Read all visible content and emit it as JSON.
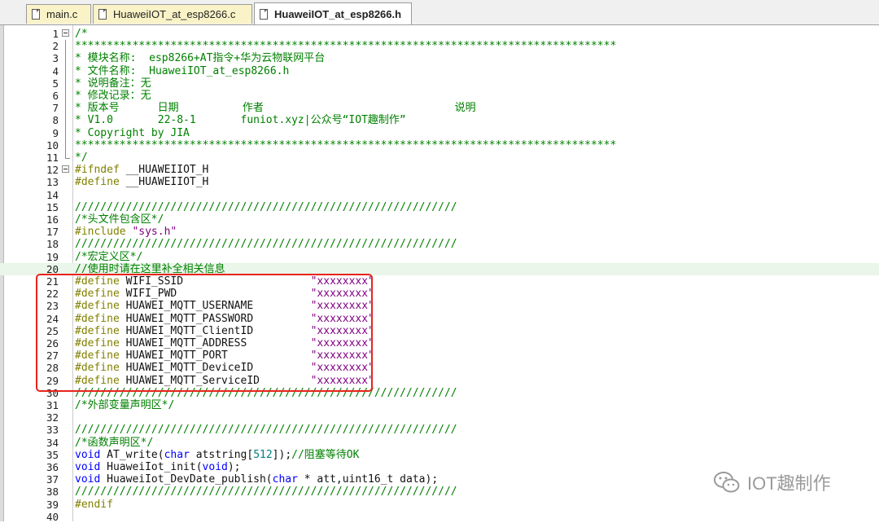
{
  "tabs": [
    {
      "label": "main.c",
      "active": false
    },
    {
      "label": "HuaweiIOT_at_esp8266.c",
      "active": false
    },
    {
      "label": "HuaweiIOT_at_esp8266.h",
      "active": true
    }
  ],
  "colors": {
    "comment": "#008000",
    "preprocessor": "#808000",
    "string": "#800080",
    "keyword": "#0000ff",
    "number": "#008080",
    "highlight_box": "#e8241c",
    "current_line": "#e9f6e9"
  },
  "editor": {
    "highlighted_line": 20,
    "lines": [
      {
        "n": "1",
        "fold": "open",
        "tokens": [
          {
            "t": "/*",
            "c": "com"
          }
        ]
      },
      {
        "n": "2",
        "tokens": [
          {
            "t": "*************************************************************************************",
            "c": "com"
          }
        ]
      },
      {
        "n": "3",
        "tokens": [
          {
            "t": "* 模块名称:  esp8266+AT指令+华为云物联网平台",
            "c": "com"
          }
        ]
      },
      {
        "n": "4",
        "tokens": [
          {
            "t": "* 文件名称:  HuaweiIOT_at_esp8266.h",
            "c": "com"
          }
        ]
      },
      {
        "n": "5",
        "tokens": [
          {
            "t": "* 说明备注：无",
            "c": "com"
          }
        ]
      },
      {
        "n": "6",
        "tokens": [
          {
            "t": "* 修改记录：无",
            "c": "com"
          }
        ]
      },
      {
        "n": "7",
        "tokens": [
          {
            "t": "* 版本号      日期          作者                              说明",
            "c": "com"
          }
        ]
      },
      {
        "n": "8",
        "tokens": [
          {
            "t": "* V1.0       22-8-1       funiot.xyz|公众号“IOT趣制作”",
            "c": "com"
          }
        ]
      },
      {
        "n": "9",
        "tokens": [
          {
            "t": "* Copyright by JIA",
            "c": "com"
          }
        ]
      },
      {
        "n": "10",
        "tokens": [
          {
            "t": "*************************************************************************************",
            "c": "com"
          }
        ]
      },
      {
        "n": "11",
        "fold": "end",
        "tokens": [
          {
            "t": "*/",
            "c": "com"
          }
        ]
      },
      {
        "n": "12",
        "fold": "open",
        "tokens": [
          {
            "t": "#ifndef ",
            "c": "pp"
          },
          {
            "t": "__HUAWEIIOT_H",
            "c": "txt"
          }
        ]
      },
      {
        "n": "13",
        "tokens": [
          {
            "t": "#define ",
            "c": "pp"
          },
          {
            "t": "__HUAWEIIOT_H",
            "c": "txt"
          }
        ]
      },
      {
        "n": "14",
        "tokens": []
      },
      {
        "n": "15",
        "tokens": [
          {
            "t": "////////////////////////////////////////////////////////////",
            "c": "com"
          }
        ]
      },
      {
        "n": "16",
        "tokens": [
          {
            "t": "/*头文件包含区*/",
            "c": "com"
          }
        ]
      },
      {
        "n": "17",
        "tokens": [
          {
            "t": "#include ",
            "c": "pp"
          },
          {
            "t": "\"sys.h\"",
            "c": "str"
          }
        ]
      },
      {
        "n": "18",
        "tokens": [
          {
            "t": "////////////////////////////////////////////////////////////",
            "c": "com"
          }
        ]
      },
      {
        "n": "19",
        "tokens": [
          {
            "t": "/*宏定义区*/",
            "c": "com"
          }
        ]
      },
      {
        "n": "20",
        "tokens": [
          {
            "t": "//使用时请在这里补全相关信息",
            "c": "com"
          }
        ]
      },
      {
        "n": "21",
        "tokens": [
          {
            "t": "#define ",
            "c": "pp"
          },
          {
            "t": "WIFI_SSID                    ",
            "c": "txt"
          },
          {
            "t": "\"xxxxxxxx\"",
            "c": "str"
          }
        ]
      },
      {
        "n": "22",
        "tokens": [
          {
            "t": "#define ",
            "c": "pp"
          },
          {
            "t": "WIFI_PWD                     ",
            "c": "txt"
          },
          {
            "t": "\"xxxxxxxx\"",
            "c": "str"
          }
        ]
      },
      {
        "n": "23",
        "tokens": [
          {
            "t": "#define ",
            "c": "pp"
          },
          {
            "t": "HUAWEI_MQTT_USERNAME         ",
            "c": "txt"
          },
          {
            "t": "\"xxxxxxxx\"",
            "c": "str"
          }
        ]
      },
      {
        "n": "24",
        "tokens": [
          {
            "t": "#define ",
            "c": "pp"
          },
          {
            "t": "HUAWEI_MQTT_PASSWORD         ",
            "c": "txt"
          },
          {
            "t": "\"xxxxxxxx\"",
            "c": "str"
          }
        ]
      },
      {
        "n": "25",
        "tokens": [
          {
            "t": "#define ",
            "c": "pp"
          },
          {
            "t": "HUAWEI_MQTT_ClientID         ",
            "c": "txt"
          },
          {
            "t": "\"xxxxxxxx\"",
            "c": "str"
          }
        ]
      },
      {
        "n": "26",
        "tokens": [
          {
            "t": "#define ",
            "c": "pp"
          },
          {
            "t": "HUAWEI_MQTT_ADDRESS          ",
            "c": "txt"
          },
          {
            "t": "\"xxxxxxxx\"",
            "c": "str"
          }
        ]
      },
      {
        "n": "27",
        "tokens": [
          {
            "t": "#define ",
            "c": "pp"
          },
          {
            "t": "HUAWEI_MQTT_PORT             ",
            "c": "txt"
          },
          {
            "t": "\"xxxxxxxx\"",
            "c": "str"
          }
        ]
      },
      {
        "n": "28",
        "tokens": [
          {
            "t": "#define ",
            "c": "pp"
          },
          {
            "t": "HUAWEI_MQTT_DeviceID         ",
            "c": "txt"
          },
          {
            "t": "\"xxxxxxxx\"",
            "c": "str"
          }
        ]
      },
      {
        "n": "29",
        "tokens": [
          {
            "t": "#define ",
            "c": "pp"
          },
          {
            "t": "HUAWEI_MQTT_ServiceID        ",
            "c": "txt"
          },
          {
            "t": "\"xxxxxxxx\"",
            "c": "str"
          }
        ]
      },
      {
        "n": "30",
        "tokens": [
          {
            "t": "////////////////////////////////////////////////////////////",
            "c": "com"
          }
        ]
      },
      {
        "n": "31",
        "tokens": [
          {
            "t": "/*外部变量声明区*/",
            "c": "com"
          }
        ]
      },
      {
        "n": "32",
        "tokens": []
      },
      {
        "n": "33",
        "tokens": [
          {
            "t": "////////////////////////////////////////////////////////////",
            "c": "com"
          }
        ]
      },
      {
        "n": "34",
        "tokens": [
          {
            "t": "/*函数声明区*/",
            "c": "com"
          }
        ]
      },
      {
        "n": "35",
        "tokens": [
          {
            "t": "void ",
            "c": "kw"
          },
          {
            "t": "AT_write(",
            "c": "txt"
          },
          {
            "t": "char ",
            "c": "kw"
          },
          {
            "t": "atstring[",
            "c": "txt"
          },
          {
            "t": "512",
            "c": "num"
          },
          {
            "t": "]);",
            "c": "txt"
          },
          {
            "t": "//阻塞等待OK",
            "c": "com"
          }
        ]
      },
      {
        "n": "36",
        "tokens": [
          {
            "t": "void ",
            "c": "kw"
          },
          {
            "t": "HuaweiIot_init(",
            "c": "txt"
          },
          {
            "t": "void",
            "c": "kw"
          },
          {
            "t": ");",
            "c": "txt"
          }
        ]
      },
      {
        "n": "37",
        "tokens": [
          {
            "t": "void ",
            "c": "kw"
          },
          {
            "t": "HuaweiIot_DevDate_publish(",
            "c": "txt"
          },
          {
            "t": "char ",
            "c": "kw"
          },
          {
            "t": "* att,uint16_t data);",
            "c": "txt"
          }
        ]
      },
      {
        "n": "38",
        "tokens": [
          {
            "t": "////////////////////////////////////////////////////////////",
            "c": "com"
          }
        ]
      },
      {
        "n": "39",
        "tokens": [
          {
            "t": "#endif",
            "c": "pp"
          }
        ]
      },
      {
        "n": "40",
        "tokens": []
      }
    ]
  },
  "watermark": {
    "text": "IOT趣制作",
    "icon": "wechat-icon"
  }
}
